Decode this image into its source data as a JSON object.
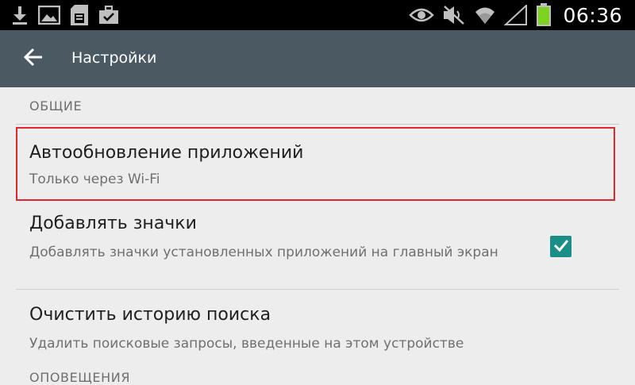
{
  "status_bar": {
    "left_icons": [
      "download-icon",
      "gallery-icon",
      "sd-card-icon",
      "briefcase-icon"
    ],
    "right_icons": [
      "eye-icon",
      "mute-icon",
      "wifi-icon",
      "signal-icon",
      "battery-icon"
    ],
    "time": "06:36"
  },
  "action_bar": {
    "back_icon": "arrow-back-icon",
    "title": "Настройки",
    "background_color": "#4b5a62"
  },
  "sections": [
    {
      "header": "ОБЩИЕ",
      "items": [
        {
          "title": "Автообновление приложений",
          "summary": "Только через Wi-Fi",
          "highlighted": true
        },
        {
          "title": "Добавлять значки",
          "summary": "Добавлять значки установленных приложений на главный экран",
          "checkbox": true,
          "checked": true
        },
        {
          "title": "Очистить историю поиска",
          "summary": "Удалить поисковые запросы, введенные на этом устройстве"
        }
      ]
    },
    {
      "header": "ОПОВЕЩЕНИЯ"
    }
  ],
  "colors": {
    "accent_checkbox": "#1a8f87",
    "highlight_border": "#e0272c",
    "background": "#ededed"
  }
}
